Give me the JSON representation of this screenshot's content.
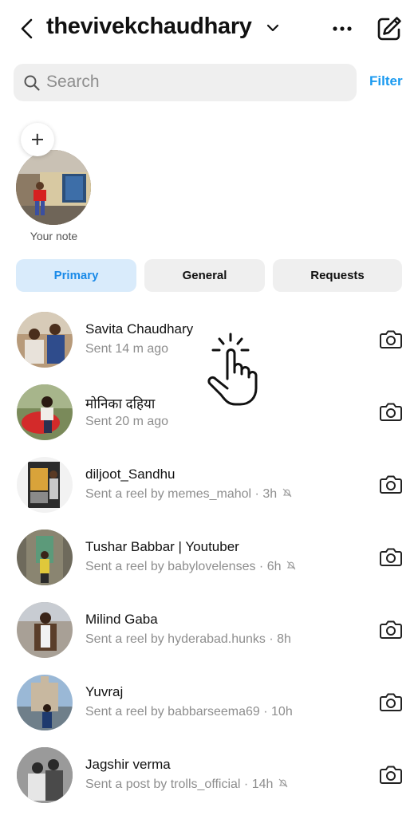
{
  "header": {
    "username": "thevivekchaudhary",
    "back_icon": "chevron-left-icon",
    "dropdown_icon": "chevron-down-icon",
    "more_icon": "ellipsis-icon",
    "compose_icon": "compose-icon"
  },
  "search": {
    "placeholder": "Search",
    "icon": "search-icon",
    "filter_label": "Filter"
  },
  "note": {
    "label": "Your note",
    "add_icon": "plus-icon"
  },
  "tabs": [
    {
      "label": "Primary",
      "active": true
    },
    {
      "label": "General",
      "active": false
    },
    {
      "label": "Requests",
      "active": false
    }
  ],
  "threads": [
    {
      "name": "Savita Chaudhary",
      "subtitle": "Sent 14 m ago",
      "muted": false
    },
    {
      "name": "मोनिका दहिया",
      "subtitle": "Sent 20 m ago",
      "muted": false
    },
    {
      "name": "diljoot_Sandhu",
      "subtitle": "Sent a reel by memes_mahol · 3h",
      "muted": true
    },
    {
      "name": "Tushar Babbar | Youtuber",
      "subtitle": "Sent a reel by babylovelenses · 6h",
      "muted": true
    },
    {
      "name": "Milind Gaba",
      "subtitle": "Sent a reel by hyderabad.hunks · 8h",
      "muted": false
    },
    {
      "name": "Yuvraj",
      "subtitle": "Sent a reel by babbarseema69 · 10h",
      "muted": false
    },
    {
      "name": "Jagshir verma",
      "subtitle": "Sent a post by trolls_official · 14h",
      "muted": true
    }
  ],
  "colors": {
    "accent": "#1a9af0",
    "active_tab_bg": "#d9ebfb",
    "inactive_tab_bg": "#efefef",
    "secondary_text": "#8e8e8e"
  }
}
